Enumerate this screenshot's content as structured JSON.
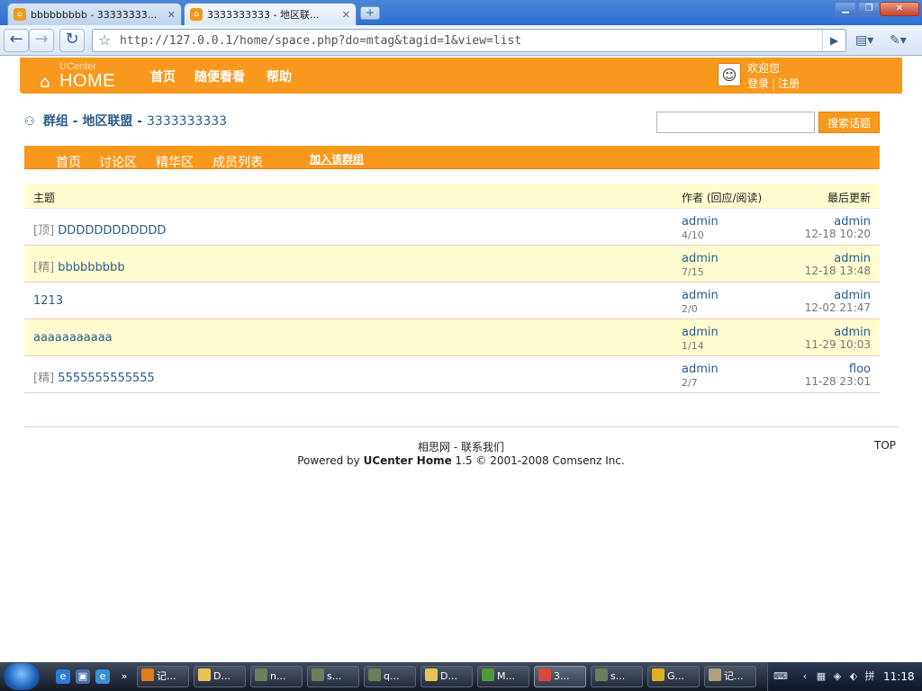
{
  "browser": {
    "tabs": [
      {
        "title": "bbbbbbbbb - 33333333...",
        "active": false
      },
      {
        "title": "3333333333 - 地区联...",
        "active": true
      }
    ],
    "new_tab": "+",
    "url": "http://127.0.0.1/home/space.php?do=mtag&tagid=1&view=list"
  },
  "site": {
    "logo_small": "UCenter",
    "logo_big": "HOME",
    "nav": [
      "首页",
      "随便看看",
      "帮助"
    ],
    "welcome": "欢迎您",
    "login": "登录",
    "separator": "|",
    "register": "注册"
  },
  "group": {
    "label": "群组",
    "sep1": " - ",
    "category": "地区联盟",
    "sep2": " - ",
    "name": "3333333333"
  },
  "search": {
    "button": "搜索话题"
  },
  "subnav": {
    "items": [
      "首页",
      "讨论区",
      "精华区",
      "成员列表"
    ],
    "join": "加入该群组"
  },
  "table": {
    "headers": {
      "subject": "主题",
      "author": "作者 (回应/阅读)",
      "last": "最后更新"
    },
    "rows": [
      {
        "tag": "[顶]",
        "subject": "DDDDDDDDDDDD",
        "author": "admin",
        "counts": "4/10",
        "last_user": "admin",
        "last_time": "12-18 10:20"
      },
      {
        "tag": "[精]",
        "subject": "bbbbbbbbb",
        "author": "admin",
        "counts": "7/15",
        "last_user": "admin",
        "last_time": "12-18 13:48"
      },
      {
        "tag": "",
        "subject": "1213",
        "author": "admin",
        "counts": "2/0",
        "last_user": "admin",
        "last_time": "12-02 21:47"
      },
      {
        "tag": "",
        "subject": "aaaaaaaaaaa",
        "author": "admin",
        "counts": "1/14",
        "last_user": "admin",
        "last_time": "11-29 10:03"
      },
      {
        "tag": "[精]",
        "subject": "5555555555555",
        "author": "admin",
        "counts": "2/7",
        "last_user": "floo",
        "last_time": "11-28 23:01"
      }
    ]
  },
  "footer": {
    "site_name": "相思网",
    "dash": " - ",
    "contact": "联系我们",
    "powered_prefix": "Powered by ",
    "product": "UCenter Home",
    "powered_suffix": " 1.5 © 2001-2008 Comsenz Inc.",
    "top": "TOP"
  },
  "taskbar": {
    "tasks": [
      {
        "label": "记...",
        "icon": "firefox-icon",
        "color": "#e07b1a"
      },
      {
        "label": "D...",
        "icon": "folder-icon",
        "color": "#e8c35a"
      },
      {
        "label": "n...",
        "icon": "editor-icon",
        "color": "#6a7f5a"
      },
      {
        "label": "s...",
        "icon": "editor-icon",
        "color": "#6a7f5a"
      },
      {
        "label": "q...",
        "icon": "editor-icon",
        "color": "#6a7f5a"
      },
      {
        "label": "D...",
        "icon": "folder-icon",
        "color": "#e8c35a"
      },
      {
        "label": "M...",
        "icon": "eclipse-icon",
        "color": "#4f9a3a"
      },
      {
        "label": "3...",
        "icon": "chrome-icon",
        "color": "#d9473a"
      },
      {
        "label": "s...",
        "icon": "editor-icon",
        "color": "#6a7f5a"
      },
      {
        "label": "G...",
        "icon": "gtalk-icon",
        "color": "#e0b020"
      },
      {
        "label": "记...",
        "icon": "notepad-icon",
        "color": "#b0a080"
      }
    ],
    "clock": "11:18"
  }
}
